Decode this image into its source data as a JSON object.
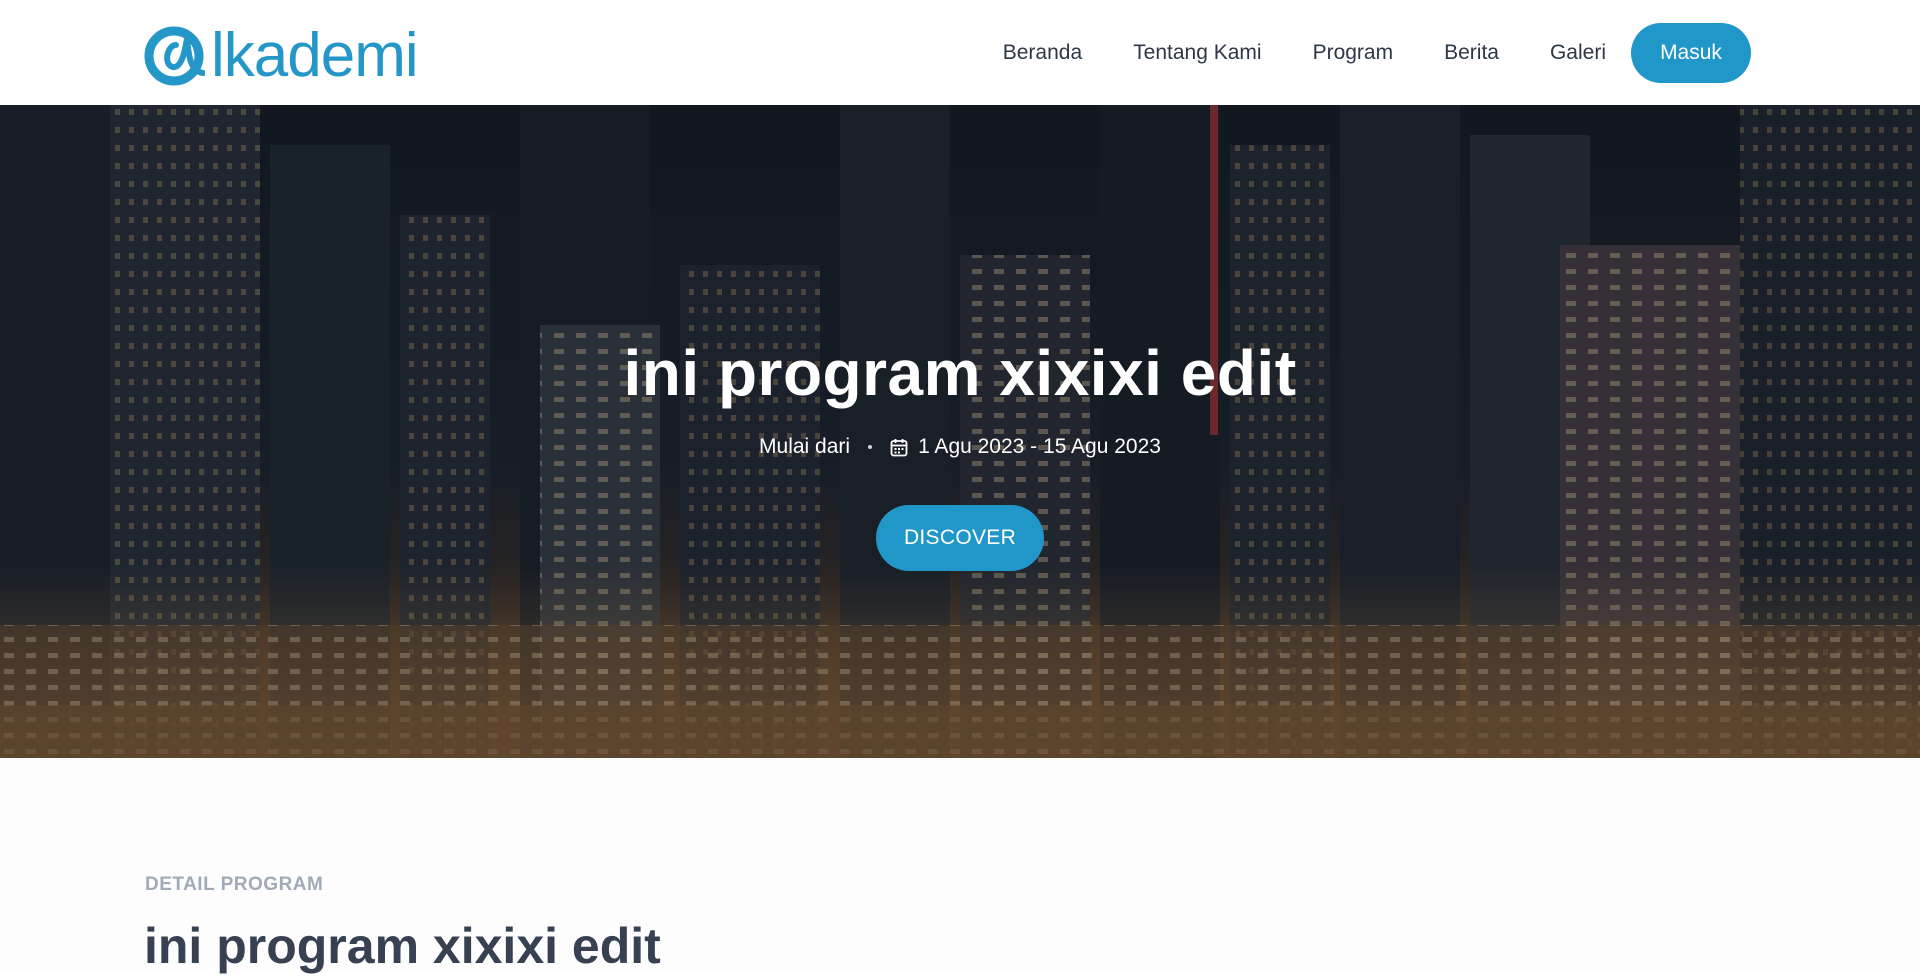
{
  "brand": {
    "logo_text": "lkademi",
    "accent_color": "#2196c8"
  },
  "nav": {
    "items": [
      "Beranda",
      "Tentang Kami",
      "Program",
      "Berita",
      "Galeri"
    ],
    "login_label": "Masuk"
  },
  "hero": {
    "title": "ini program xixixi edit",
    "start_label": "Mulai dari",
    "date_range": "1 Agu 2023 - 15 Agu 2023",
    "calendar_icon": "calendar-icon",
    "cta_label": "DISCOVER",
    "background": "night-city-skyline-photo"
  },
  "detail": {
    "section_label": "DETAIL PROGRAM",
    "title": "ini program xixixi edit"
  }
}
